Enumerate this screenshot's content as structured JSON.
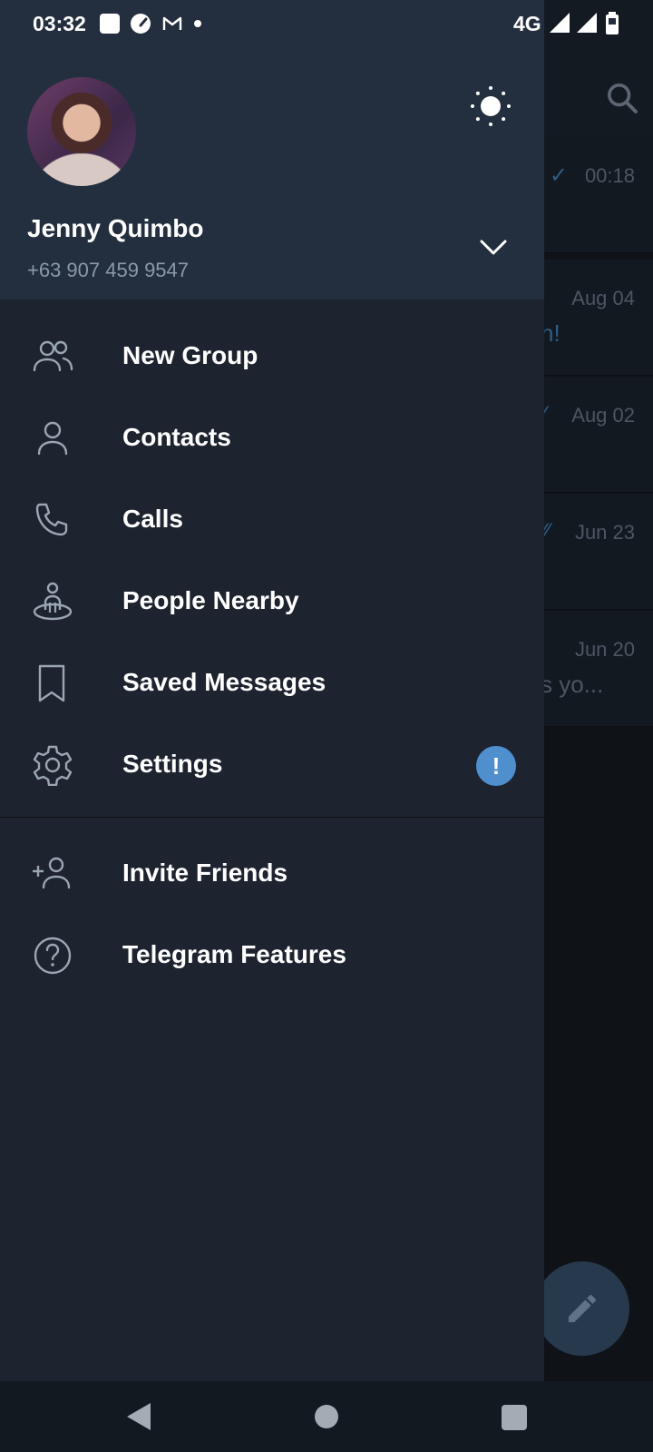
{
  "status_bar": {
    "time": "03:32",
    "network": "4G",
    "icons": [
      "notification-square-icon",
      "speedometer-icon",
      "gmail-icon",
      "dot-icon",
      "signal-icon",
      "signal-icon",
      "battery-icon"
    ]
  },
  "drawer": {
    "user_name": "Jenny Quimbo",
    "user_phone": "+63 907 459 9547",
    "menu": [
      {
        "label": "New Group",
        "icon": "new-group-icon"
      },
      {
        "label": "Contacts",
        "icon": "contacts-icon"
      },
      {
        "label": "Calls",
        "icon": "phone-icon"
      },
      {
        "label": "People Nearby",
        "icon": "people-nearby-icon"
      },
      {
        "label": "Saved Messages",
        "icon": "bookmark-icon"
      },
      {
        "label": "Settings",
        "icon": "gear-icon",
        "badge": "!"
      }
    ],
    "menu_secondary": [
      {
        "label": "Invite Friends",
        "icon": "add-user-icon"
      },
      {
        "label": "Telegram Features",
        "icon": "question-icon"
      }
    ]
  },
  "background_chats": [
    {
      "time": "00:18",
      "snippet": ""
    },
    {
      "time": "Aug 04",
      "snippet": "n!"
    },
    {
      "time": "Aug 02",
      "snippet": ""
    },
    {
      "time": "Jun 23",
      "snippet": ""
    },
    {
      "time": "Jun 20",
      "snippet": "s yo..."
    }
  ],
  "colors": {
    "drawer_bg": "#1d2430",
    "header_bg": "#232f3e",
    "badge": "#4f8fce",
    "accent": "#4f8fce"
  }
}
